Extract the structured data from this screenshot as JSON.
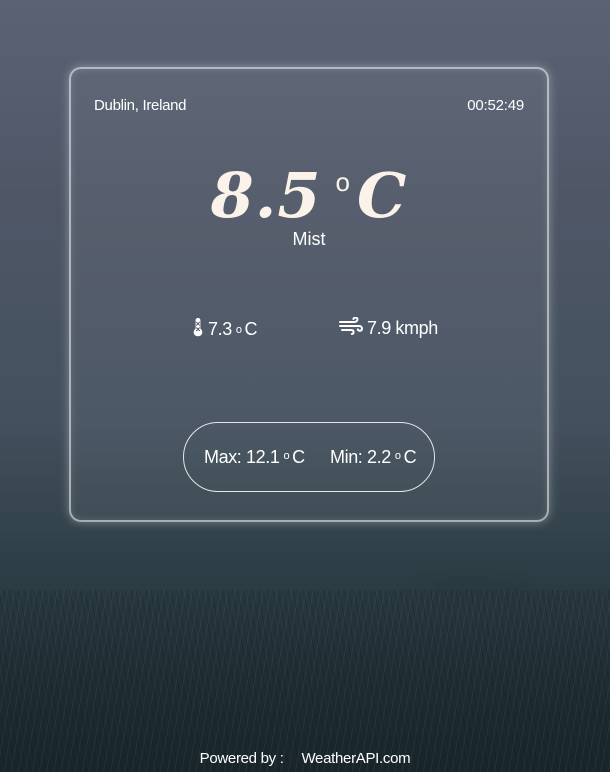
{
  "location": "Dublin, Ireland",
  "time": "00:52:49",
  "current": {
    "temperature": "8.5",
    "degree_symbol": "o",
    "unit": "C",
    "condition": "Mist"
  },
  "feels_like": {
    "icon": "thermometer-icon",
    "value": "7.3",
    "degree_symbol": "o",
    "unit": "C"
  },
  "wind": {
    "icon": "wind-icon",
    "value": "7.9 kmph"
  },
  "range": {
    "max_label": "Max: 12.1",
    "min_label": "Min: 2.2",
    "degree_symbol": "o",
    "unit": "C"
  },
  "footer": {
    "powered_by": "Powered by :",
    "provider": "WeatherAPI.com"
  }
}
